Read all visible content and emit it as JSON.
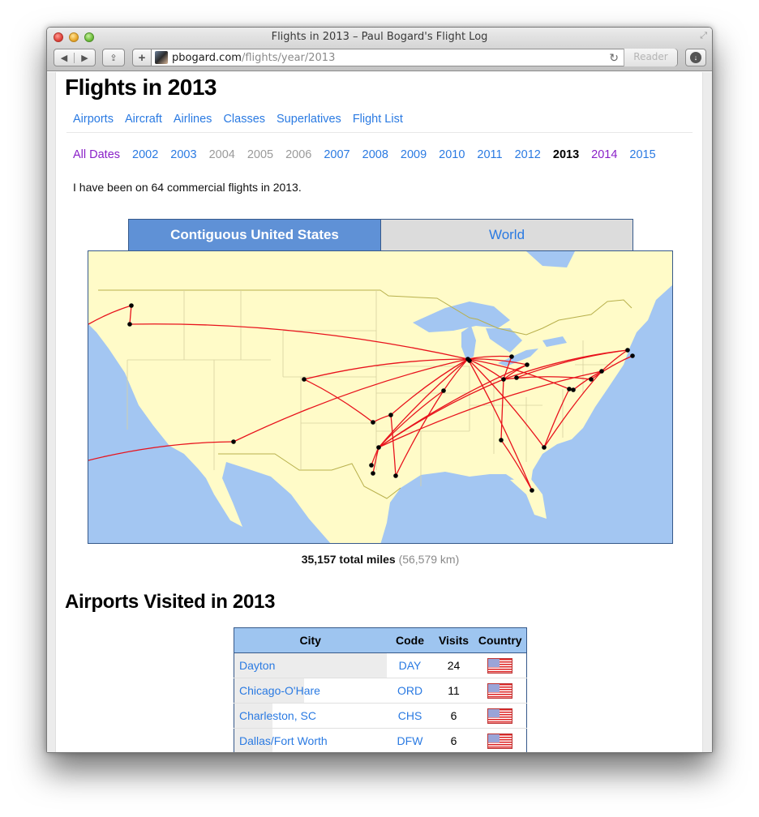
{
  "browser": {
    "window_title": "Flights in 2013 – Paul Bogard's Flight Log",
    "url_host": "pbogard.com",
    "url_path": "/flights/year/2013",
    "reader_label": "Reader"
  },
  "page": {
    "title": "Flights in 2013",
    "nav": [
      "Airports",
      "Aircraft",
      "Airlines",
      "Classes",
      "Superlatives",
      "Flight List"
    ],
    "years": [
      {
        "label": "All Dates",
        "state": "visited"
      },
      {
        "label": "2002",
        "state": "link"
      },
      {
        "label": "2003",
        "state": "link"
      },
      {
        "label": "2004",
        "state": "disabled"
      },
      {
        "label": "2005",
        "state": "disabled"
      },
      {
        "label": "2006",
        "state": "disabled"
      },
      {
        "label": "2007",
        "state": "link"
      },
      {
        "label": "2008",
        "state": "link"
      },
      {
        "label": "2009",
        "state": "link"
      },
      {
        "label": "2010",
        "state": "link"
      },
      {
        "label": "2011",
        "state": "link"
      },
      {
        "label": "2012",
        "state": "link"
      },
      {
        "label": "2013",
        "state": "current"
      },
      {
        "label": "2014",
        "state": "visited"
      },
      {
        "label": "2015",
        "state": "link"
      }
    ],
    "intro": "I have been on 64 commercial flights in 2013.",
    "map_tabs": {
      "active": "Contiguous United States",
      "inactive": "World"
    },
    "total_miles": "35,157 total miles",
    "total_km": "(56,579 km)",
    "airports_title": "Airports Visited in 2013",
    "table": {
      "headers": [
        "City",
        "Code",
        "Visits",
        "Country"
      ],
      "rows": [
        {
          "city": "Dayton",
          "code": "DAY",
          "visits": "24",
          "country": "us-flag",
          "bar": 1.0
        },
        {
          "city": "Chicago-O'Hare",
          "code": "ORD",
          "visits": "11",
          "country": "us-flag",
          "bar": 0.46
        },
        {
          "city": "Charleston, SC",
          "code": "CHS",
          "visits": "6",
          "country": "us-flag",
          "bar": 0.25
        },
        {
          "city": "Dallas/Fort Worth",
          "code": "DFW",
          "visits": "6",
          "country": "us-flag",
          "bar": 0.25
        }
      ]
    }
  },
  "colors": {
    "link": "#2a7ae2",
    "visited": "#8a20c8",
    "route": "#e8121c",
    "land": "#fffbc8",
    "water": "#a3c6f2",
    "tab_active": "#5f91d6"
  }
}
